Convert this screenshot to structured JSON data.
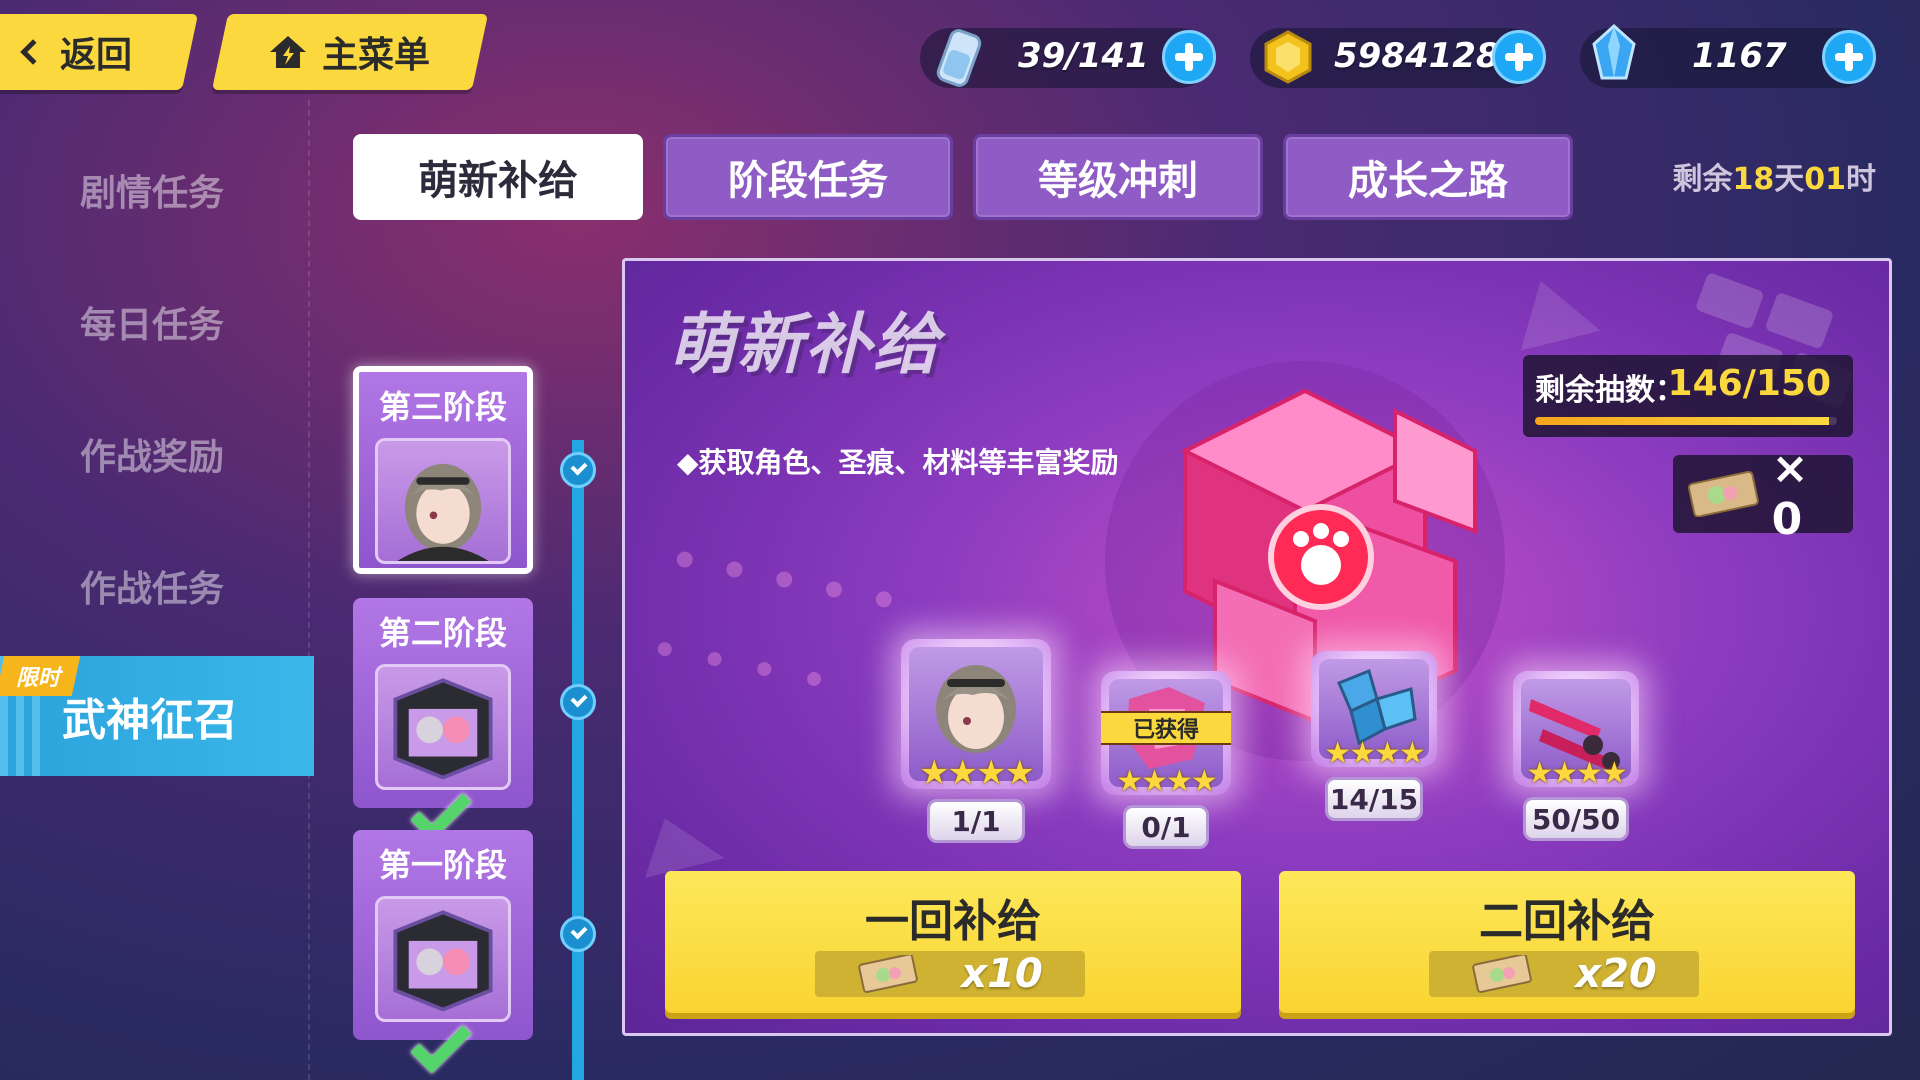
{
  "topbar": {
    "back_label": "返回",
    "menu_label": "主菜单",
    "stamina": "39/141",
    "coins": "5984128",
    "crystals": "1167"
  },
  "sidebar": {
    "items": [
      "剧情任务",
      "每日任务",
      "作战奖励",
      "作战任务"
    ],
    "active": "武神征召",
    "limited_tag": "限时"
  },
  "tabs": [
    "萌新补给",
    "阶段任务",
    "等级冲刺",
    "成长之路"
  ],
  "remaining": {
    "prefix": "剩余",
    "days": "18",
    "day_unit": "天",
    "hours": "01",
    "hour_unit": "时"
  },
  "stages": [
    {
      "title": "第三阶段",
      "done": false
    },
    {
      "title": "第二阶段",
      "done": true
    },
    {
      "title": "第一阶段",
      "done": true
    }
  ],
  "panel": {
    "title": "萌新补给",
    "description": "◆获取角色、圣痕、材料等丰富奖励",
    "draws_label": "剩余抽数：",
    "draws_value": "146/150",
    "draws_progress": 0.973,
    "ticket_count": "× 0",
    "rewards": [
      {
        "name": "character",
        "count": "1/1",
        "stars": "★★★★"
      },
      {
        "name": "stigmata",
        "count": "0/1",
        "stars": "★★★★",
        "obtained": "已获得"
      },
      {
        "name": "material",
        "count": "14/15",
        "stars": "★★★★"
      },
      {
        "name": "weapon",
        "count": "50/50",
        "stars": "★★★★"
      }
    ],
    "supply_one": {
      "label": "一回补给",
      "cost": "x10"
    },
    "supply_two": {
      "label": "二回补给",
      "cost": "x20"
    }
  },
  "colors": {
    "accent_yellow": "#fbd93e",
    "accent_blue": "#23a7e3",
    "tab_purple": "#8e5cc4"
  }
}
